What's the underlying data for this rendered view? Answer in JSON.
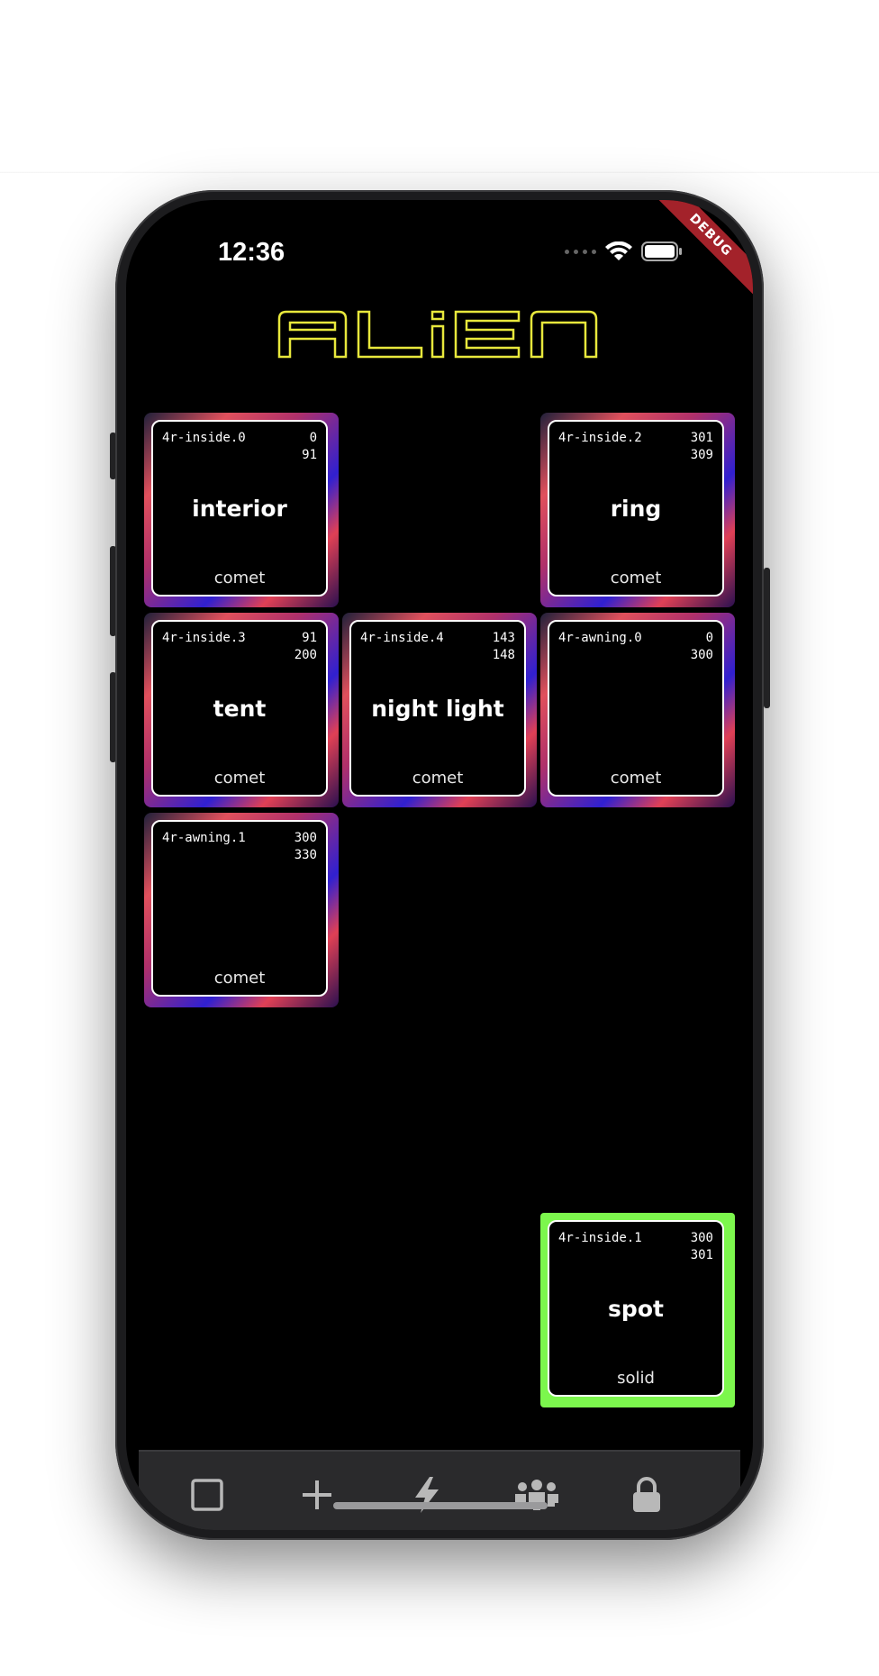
{
  "status": {
    "time": "12:36",
    "debug_label": "DEBUG"
  },
  "app": {
    "logo_text": "ALiEN"
  },
  "tiles": [
    {
      "id": "4r-inside.0",
      "n1": "0",
      "n2": "91",
      "label": "interior",
      "mode": "comet"
    },
    {
      "id": "4r-inside.2",
      "n1": "301",
      "n2": "309",
      "label": "ring",
      "mode": "comet"
    },
    {
      "id": "4r-inside.3",
      "n1": "91",
      "n2": "200",
      "label": "tent",
      "mode": "comet"
    },
    {
      "id": "4r-inside.4",
      "n1": "143",
      "n2": "148",
      "label": "night light",
      "mode": "comet"
    },
    {
      "id": "4r-awning.0",
      "n1": "0",
      "n2": "300",
      "label": "",
      "mode": "comet"
    },
    {
      "id": "4r-awning.1",
      "n1": "300",
      "n2": "330",
      "label": "",
      "mode": "comet"
    },
    {
      "id": "4r-inside.1",
      "n1": "300",
      "n2": "301",
      "label": "spot",
      "mode": "solid"
    }
  ],
  "tabs": [
    {
      "icon": "square-icon"
    },
    {
      "icon": "plus-icon"
    },
    {
      "icon": "lightning-icon"
    },
    {
      "icon": "group-icon"
    },
    {
      "icon": "lock-icon"
    }
  ],
  "colors": {
    "logo": "#e8e83c",
    "solid_tile": "#7cf74d",
    "background": "#000000"
  }
}
